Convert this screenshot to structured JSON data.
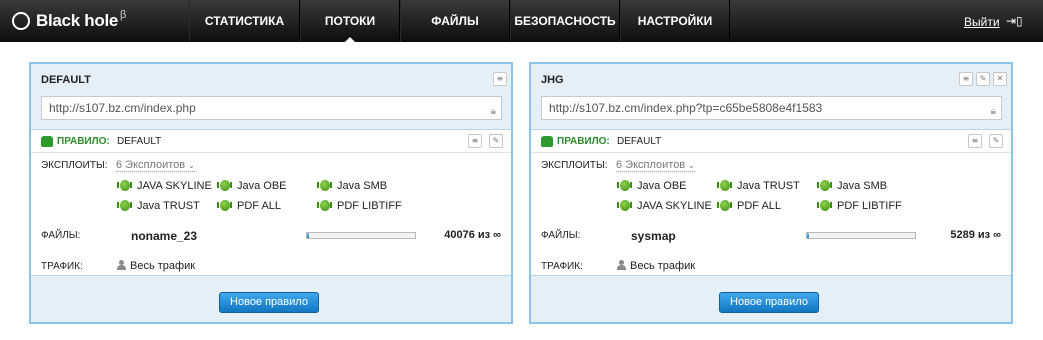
{
  "app": {
    "name": "Black hole",
    "beta": "β"
  },
  "nav": {
    "items": [
      {
        "label": "СТАТИСТИКА"
      },
      {
        "label": "ПОТОКИ"
      },
      {
        "label": "ФАЙЛЫ"
      },
      {
        "label": "БЕЗОПАСНОСТЬ"
      },
      {
        "label": "НАСТРОЙКИ"
      }
    ],
    "active": "ПОТОКИ"
  },
  "logout": {
    "label": "Выйти"
  },
  "colors": {
    "accent": "#1b7fc6",
    "panel_border": "#8cc3e8",
    "rule_green": "#2b8d2b",
    "topbar": "#111111"
  },
  "labels": {
    "rule": "ПРАВИЛО:",
    "exploits": "ЭКСПЛОИТЫ:",
    "files": "ФАЙЛЫ:",
    "traffic": "ТРАФИК:",
    "new_rule": "Новое правило"
  },
  "streams": [
    {
      "title": "DEFAULT",
      "url": "http://s107.bz.cm/index.php",
      "rule": "DEFAULT",
      "exploit_count": "6 Эксплоитов",
      "exploits": [
        "JAVA SKYLINE",
        "Java OBE",
        "Java SMB",
        "Java TRUST",
        "PDF ALL",
        "PDF LIBTIFF"
      ],
      "file": "noname_23",
      "progress": 0.02,
      "count": "40076 из ∞",
      "traffic": "Весь трафик",
      "buttons": [
        "notes-icon"
      ]
    },
    {
      "title": "JHG",
      "url": "http://s107.bz.cm/index.php?tp=c65be5808e4f1583",
      "rule": "DEFAULT",
      "exploit_count": "6 Эксплоитов",
      "exploits": [
        "Java OBE",
        "Java TRUST",
        "Java SMB",
        "JAVA SKYLINE",
        "PDF ALL",
        "PDF LIBTIFF"
      ],
      "file": "sysmap",
      "progress": 0.02,
      "count": "5289 из ∞",
      "traffic": "Весь трафик",
      "buttons": [
        "notes-icon",
        "wrench-icon",
        "close-icon"
      ]
    }
  ]
}
